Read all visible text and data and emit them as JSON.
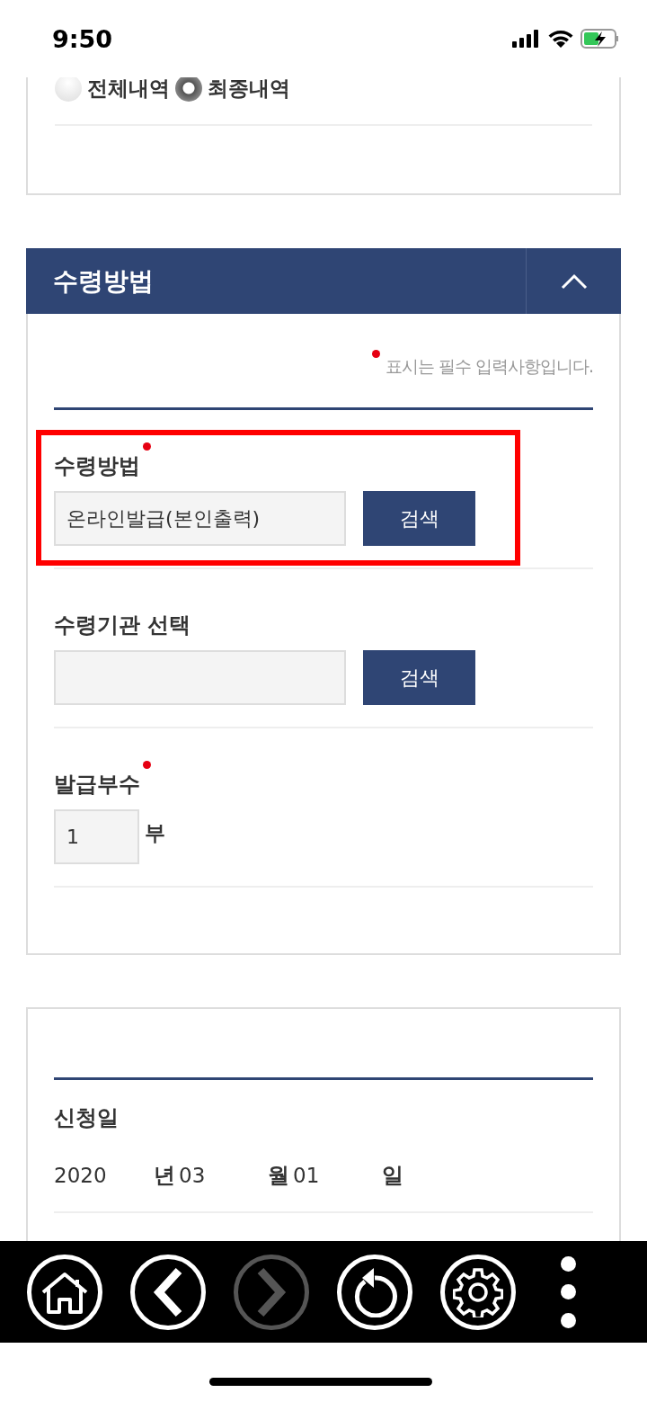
{
  "status_bar": {
    "time": "9:50"
  },
  "history_filter": {
    "options": [
      {
        "label": "전체내역",
        "selected": false
      },
      {
        "label": "최종내역",
        "selected": true
      }
    ]
  },
  "receipt_section": {
    "title": "수령방법",
    "expanded": true,
    "required_note": "표시는 필수 입력사항입니다.",
    "fields": [
      {
        "kind": "search",
        "label": "수령방법",
        "required": true,
        "highlighted": true,
        "value": "온라인발급(본인출력)",
        "button": "검색"
      },
      {
        "kind": "search",
        "label": "수령기관 선택",
        "required": false,
        "highlighted": false,
        "button": "검색"
      },
      {
        "kind": "count",
        "label": "발급부수",
        "required": true,
        "highlighted": false,
        "value": "1",
        "unit": "부"
      }
    ]
  },
  "application_section": {
    "label": "신청일",
    "date_parts": [
      {
        "value": "2020",
        "unit": "년"
      },
      {
        "value": "03",
        "unit": "월"
      },
      {
        "value": "01",
        "unit": "일"
      }
    ]
  },
  "toolbar": {
    "buttons": [
      {
        "kind": "home",
        "disabled": false
      },
      {
        "kind": "back",
        "disabled": false
      },
      {
        "kind": "forward",
        "disabled": true
      },
      {
        "kind": "reload",
        "disabled": false
      },
      {
        "kind": "settings",
        "disabled": false
      },
      {
        "kind": "more",
        "disabled": false
      }
    ]
  }
}
